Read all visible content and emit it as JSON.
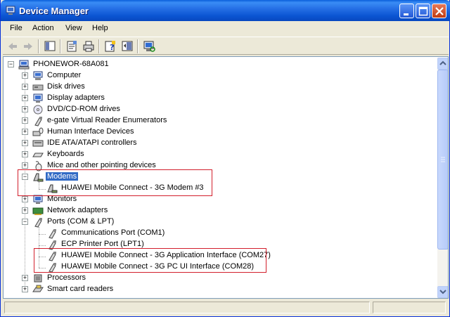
{
  "window": {
    "title": "Device Manager"
  },
  "menu": [
    "File",
    "Action",
    "View",
    "Help"
  ],
  "toolbar": {
    "buttons": [
      "back-icon",
      "forward-icon",
      "show-hide-tree-icon",
      "properties-icon",
      "print-icon",
      "help-icon",
      "export-icon",
      "scan-hardware-icon"
    ]
  },
  "tree": {
    "root": "PHONEWOR-68A081",
    "categories": [
      "Computer",
      "Disk drives",
      "Display adapters",
      "DVD/CD-ROM drives",
      "e-gate Virtual Reader Enumerators",
      "Human Interface Devices",
      "IDE ATA/ATAPI controllers",
      "Keyboards",
      "Mice and other pointing devices",
      "Modems",
      "Monitors",
      "Network adapters",
      "Ports (COM & LPT)",
      "Processors",
      "Smart card readers"
    ],
    "modems_children": [
      "HUAWEI Mobile Connect - 3G Modem #3"
    ],
    "ports_children": [
      "Communications Port (COM1)",
      "ECP Printer Port (LPT1)",
      "HUAWEI Mobile Connect - 3G Application Interface (COM27)",
      "HUAWEI Mobile Connect - 3G PC UI Interface (COM28)"
    ],
    "selected": "Modems"
  },
  "colors": {
    "titlebar": "#2670E6",
    "selection": "#316AC5",
    "highlight_box": "#D21F2C"
  }
}
